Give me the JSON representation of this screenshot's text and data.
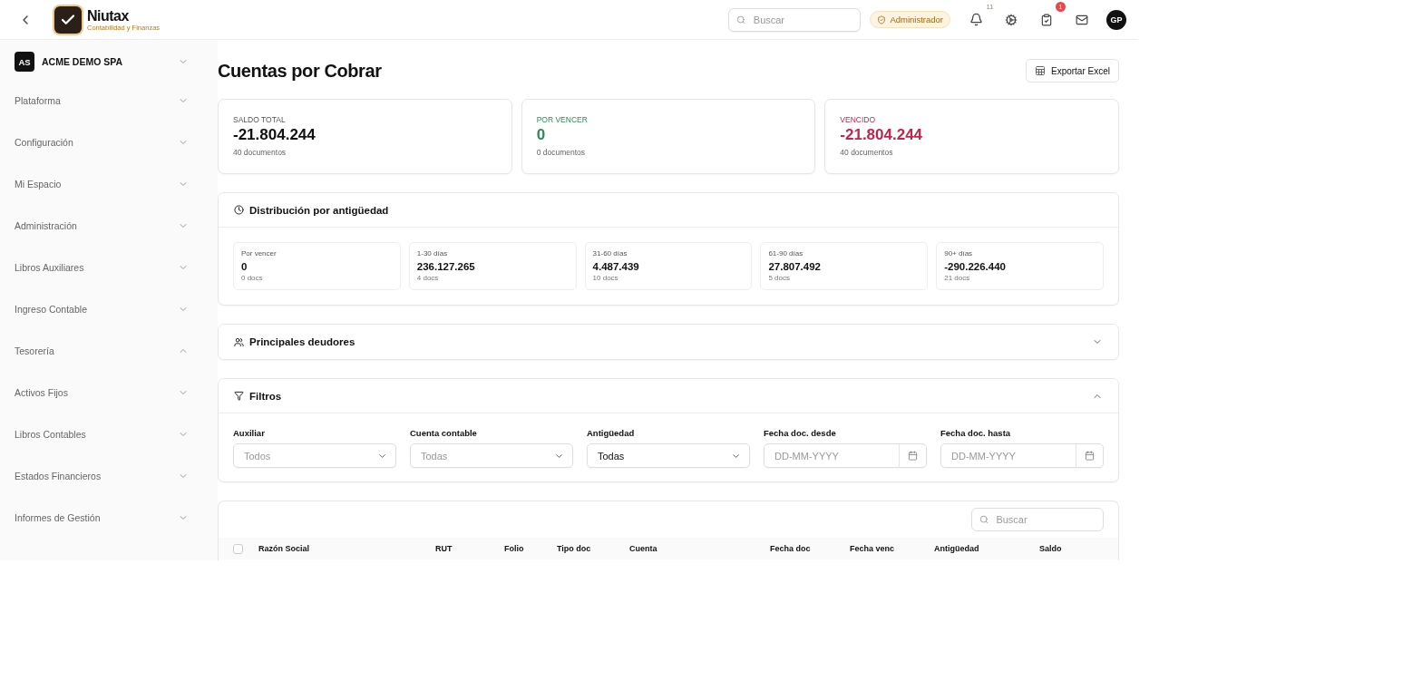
{
  "header": {
    "brand": {
      "name": "Niutax",
      "tagline": "Contabilidad y Finanzas"
    },
    "search": {
      "placeholder": "Buscar"
    },
    "role_badge": "Administrador",
    "notifications": {
      "count": "11"
    },
    "tasks": {
      "count": "1"
    },
    "avatar": "GP"
  },
  "sidebar": {
    "company": {
      "initials": "AS",
      "name": "ACME DEMO SPA"
    },
    "items": [
      {
        "label": "Plataforma",
        "expanded": false
      },
      {
        "label": "Configuración",
        "expanded": false
      },
      {
        "label": "Mi Espacio",
        "expanded": false
      },
      {
        "label": "Administración",
        "expanded": false
      },
      {
        "label": "Libros Auxiliares",
        "expanded": false
      },
      {
        "label": "Ingreso Contable",
        "expanded": false
      },
      {
        "label": "Tesorería",
        "expanded": true
      },
      {
        "label": "Activos Fijos",
        "expanded": false
      },
      {
        "label": "Libros Contables",
        "expanded": false
      },
      {
        "label": "Estados Financieros",
        "expanded": false
      },
      {
        "label": "Informes de Gestión",
        "expanded": false
      }
    ]
  },
  "page": {
    "title": "Cuentas por Cobrar",
    "export_button": "Exportar Excel"
  },
  "summary_cards": [
    {
      "label": "SALDO TOTAL",
      "value": "-21.804.244",
      "detail": "40 documentos",
      "kind": "neutral"
    },
    {
      "label": "POR VENCER",
      "value": "0",
      "detail": "0 documentos",
      "kind": "positive"
    },
    {
      "label": "VENCIDO",
      "value": "-21.804.244",
      "detail": "40 documentos",
      "kind": "negative"
    }
  ],
  "aging": {
    "title": "Distribución por antigüedad",
    "buckets": [
      {
        "label": "Por vencer",
        "value": "0",
        "docs": "0 docs"
      },
      {
        "label": "1-30 días",
        "value": "236.127.265",
        "docs": "4 docs"
      },
      {
        "label": "31-60 días",
        "value": "4.487.439",
        "docs": "10 docs"
      },
      {
        "label": "61-90 días",
        "value": "27.807.492",
        "docs": "5 docs"
      },
      {
        "label": "90+ días",
        "value": "-290.226.440",
        "docs": "21 docs"
      }
    ]
  },
  "debtors": {
    "title": "Principales deudores",
    "expanded": false
  },
  "filters": {
    "title": "Filtros",
    "expanded": true,
    "fields": [
      {
        "label": "Auxiliar",
        "kind": "select",
        "placeholder": "Todos"
      },
      {
        "label": "Cuenta contable",
        "kind": "select",
        "placeholder": "Todas"
      },
      {
        "label": "Antigüedad",
        "kind": "select",
        "value": "Todas"
      },
      {
        "label": "Fecha doc. desde",
        "kind": "date",
        "placeholder": "DD-MM-YYYY"
      },
      {
        "label": "Fecha doc. hasta",
        "kind": "date",
        "placeholder": "DD-MM-YYYY"
      }
    ]
  },
  "table": {
    "search": {
      "placeholder": "Buscar"
    },
    "select_all": {
      "checked": false
    },
    "columns": [
      "Razón Social",
      "RUT",
      "Folio",
      "Tipo doc",
      "Cuenta",
      "Fecha doc",
      "Fecha venc",
      "Antigüedad",
      "Saldo"
    ]
  }
}
